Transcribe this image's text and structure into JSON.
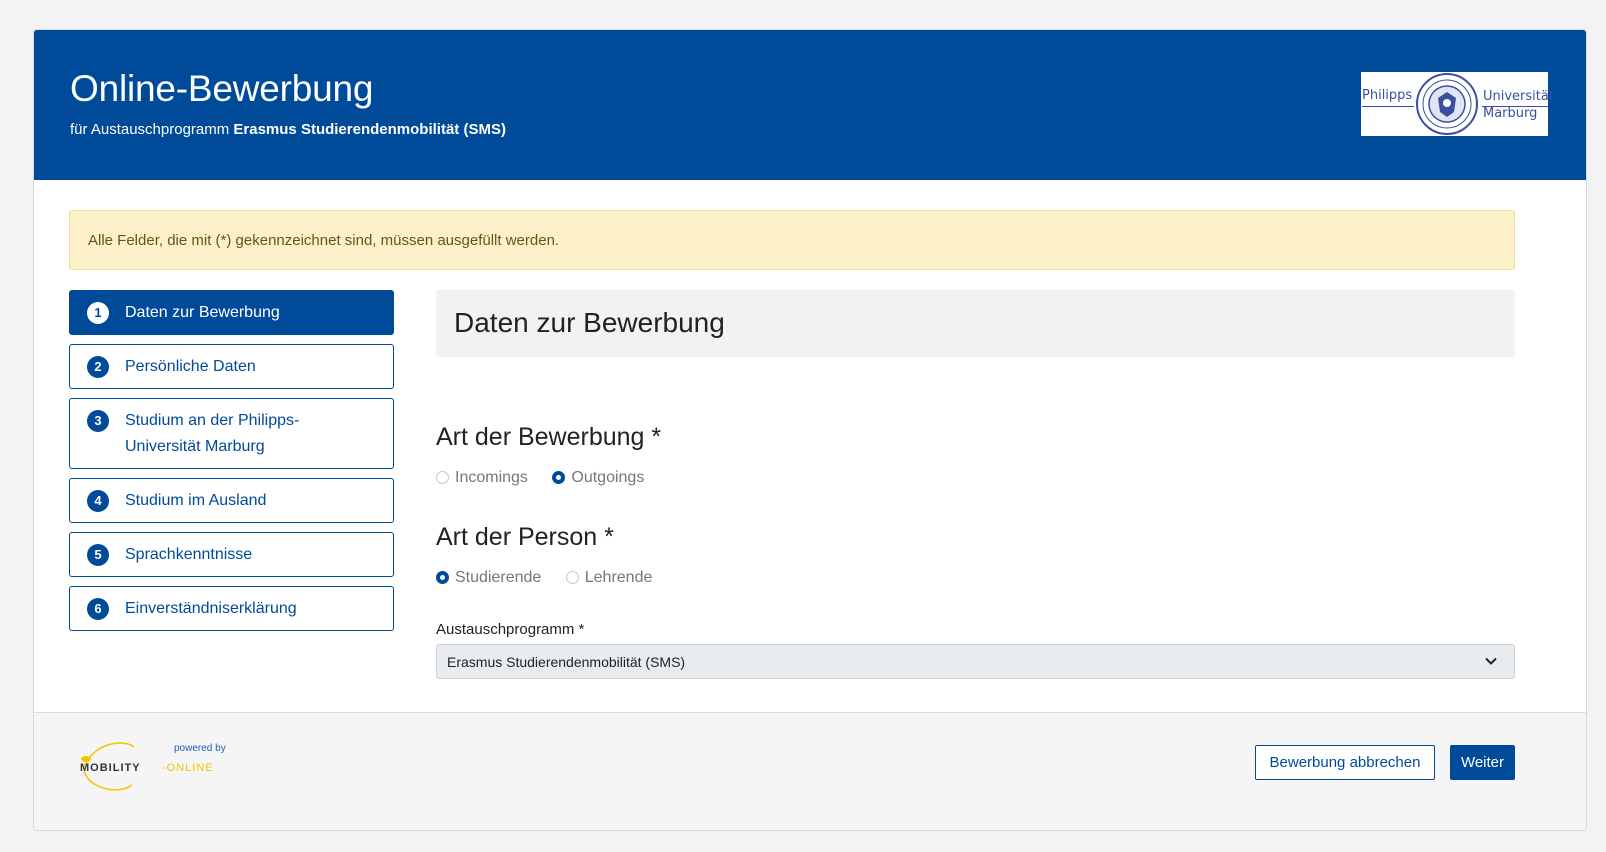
{
  "header": {
    "title": "Online-Bewerbung",
    "subtitle_prefix": "für Austauschprogramm ",
    "subtitle_program": "Erasmus Studierendenmobilität (SMS)",
    "logo": {
      "left_text": "Philipps",
      "right_text_1": "Universität",
      "right_text_2": "Marburg"
    }
  },
  "notice": "Alle Felder, die mit (*) gekennzeichnet sind, müssen ausgefüllt werden.",
  "steps": [
    {
      "num": "1",
      "label": "Daten zur Bewerbung",
      "active": true
    },
    {
      "num": "2",
      "label": "Persönliche Daten",
      "active": false
    },
    {
      "num": "3",
      "label": "Studium an der Philipps-",
      "label2": "Universität Marburg",
      "active": false
    },
    {
      "num": "4",
      "label": "Studium im Ausland",
      "active": false
    },
    {
      "num": "5",
      "label": "Sprachkenntnisse",
      "active": false
    },
    {
      "num": "6",
      "label": "Einverständniserklärung",
      "active": false
    }
  ],
  "main": {
    "section_title": "Daten zur Bewerbung",
    "art_bewerbung": {
      "heading": "Art der Bewerbung *",
      "options": [
        "Incomings",
        "Outgoings"
      ],
      "selected": "Outgoings"
    },
    "art_person": {
      "heading": "Art der Person *",
      "options": [
        "Studierende",
        "Lehrende"
      ],
      "selected": "Studierende"
    },
    "austauschprogramm": {
      "label": "Austauschprogramm *",
      "value": "Erasmus Studierendenmobilität (SMS)"
    }
  },
  "footer": {
    "powered_by": "powered by",
    "brand_1": "MOBILITY",
    "brand_2": "-ONLINE",
    "cancel_label": "Bewerbung abbrechen",
    "next_label": "Weiter"
  },
  "colors": {
    "primary": "#004a9a",
    "notice_bg": "#fcf0c8",
    "brand_yellow": "#f2c500"
  }
}
